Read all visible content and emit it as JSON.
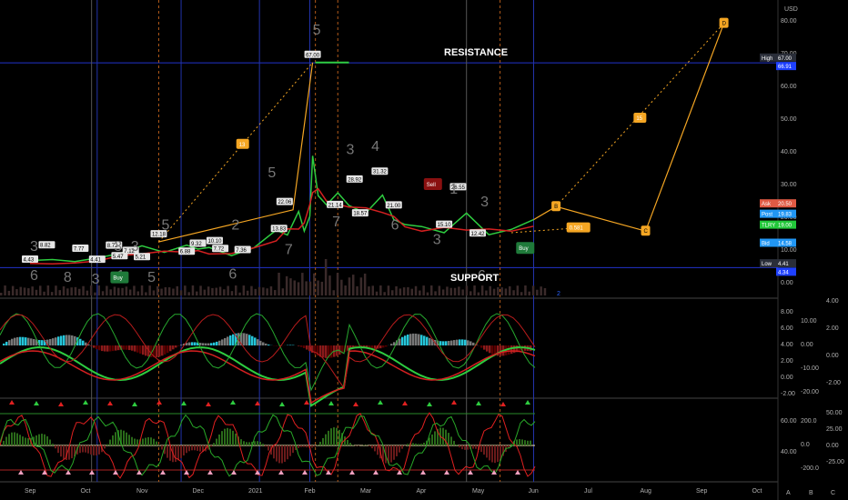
{
  "chart_data": {
    "type": "line",
    "currency": "USD",
    "ylim": [
      0,
      82
    ],
    "x_months": [
      "Sep",
      "Oct",
      "Nov",
      "Dec",
      "2021",
      "Feb",
      "Mar",
      "Apr",
      "May",
      "Jun",
      "Jul",
      "Aug",
      "Sep",
      "Oct"
    ],
    "y_ticks": [
      "80.00",
      "70.00",
      "60.00",
      "50.00",
      "40.00",
      "30.00",
      "20.00",
      "10.00",
      "0.00"
    ],
    "annotations": {
      "resistance": "RESISTANCE",
      "support": "SUPPORT"
    },
    "price_flags": [
      {
        "label": "High",
        "value": "67.00",
        "color": "#2a2e39"
      },
      {
        "label": "",
        "value": "66.91",
        "color": "#1e40ff"
      },
      {
        "label": "Ask",
        "value": "20.50",
        "color": "#e05a44"
      },
      {
        "label": "Post",
        "value": "19.83",
        "color": "#2196f3"
      },
      {
        "label": "TLRY",
        "value": "19.00",
        "color": "#22c83a"
      },
      {
        "label": "Bid",
        "value": "14.58",
        "color": "#2196f3"
      },
      {
        "label": "Low",
        "value": "4.41",
        "color": "#2a2e39"
      },
      {
        "label": "",
        "value": "4.34",
        "color": "#1e40ff"
      }
    ],
    "series": [
      {
        "name": "TLRY",
        "x": [
          0,
          0.4,
          0.8,
          1.2,
          1.6,
          2.0,
          2.4,
          2.8,
          3.0,
          3.2,
          3.6,
          4.0,
          4.4,
          4.6,
          4.8,
          4.9,
          5.0,
          5.05,
          5.15,
          5.3,
          5.5,
          5.7,
          6.0,
          6.3,
          6.5,
          6.7,
          7.0,
          7.4,
          7.8,
          8.2,
          8.6,
          9.0
        ],
        "y": [
          6.5,
          6.8,
          6.2,
          7.3,
          8.6,
          11.0,
          9.0,
          11.2,
          10.0,
          10.5,
          8.0,
          10.4,
          15.8,
          14.3,
          21.5,
          15.5,
          20.0,
          38.5,
          26.3,
          23.5,
          27.2,
          23.3,
          21.0,
          26.5,
          19.0,
          17.5,
          16.9,
          15.0,
          21.0,
          14.4,
          16.0,
          19.0
        ]
      }
    ],
    "labels": [
      {
        "x": 0.0,
        "y": 4.43,
        "text": "4.43"
      },
      {
        "x": 0.3,
        "y": 8.82,
        "text": "8.82"
      },
      {
        "x": 0.9,
        "y": 7.77,
        "text": "7.77"
      },
      {
        "x": 1.2,
        "y": 4.41,
        "text": "4.41"
      },
      {
        "x": 1.5,
        "y": 8.72,
        "text": "8.72"
      },
      {
        "x": 1.6,
        "y": 5.47,
        "text": "5.47"
      },
      {
        "x": 1.8,
        "y": 7.12,
        "text": "7.12"
      },
      {
        "x": 2.0,
        "y": 5.21,
        "text": "5.21"
      },
      {
        "x": 2.3,
        "y": 12.18,
        "text": "12.18"
      },
      {
        "x": 2.8,
        "y": 6.88,
        "text": "6.88"
      },
      {
        "x": 3.0,
        "y": 9.32,
        "text": "9.32"
      },
      {
        "x": 3.3,
        "y": 10.1,
        "text": "10.10"
      },
      {
        "x": 3.4,
        "y": 7.72,
        "text": "7.72"
      },
      {
        "x": 3.8,
        "y": 7.36,
        "text": "7.36"
      },
      {
        "x": 4.45,
        "y": 13.83,
        "text": "13.83"
      },
      {
        "x": 4.55,
        "y": 22.06,
        "text": "22.06"
      },
      {
        "x": 5.05,
        "y": 67.0,
        "text": "67.00"
      },
      {
        "x": 5.45,
        "y": 21.14,
        "text": "21.14"
      },
      {
        "x": 5.8,
        "y": 28.92,
        "text": "28.92"
      },
      {
        "x": 5.9,
        "y": 18.57,
        "text": "18.57"
      },
      {
        "x": 6.25,
        "y": 31.32,
        "text": "31.32"
      },
      {
        "x": 6.5,
        "y": 21.0,
        "text": "21.00"
      },
      {
        "x": 7.4,
        "y": 15.1,
        "text": "15.10"
      },
      {
        "x": 7.65,
        "y": 26.55,
        "text": "26.55"
      },
      {
        "x": 8.0,
        "y": 12.42,
        "text": "12.42"
      }
    ],
    "wave_numbers": [
      {
        "x": 0.0,
        "y": 9.5,
        "text": "3"
      },
      {
        "x": 0.0,
        "y": 0.5,
        "text": "6"
      },
      {
        "x": 0.6,
        "y": 0.0,
        "text": "8"
      },
      {
        "x": 1.1,
        "y": -0.5,
        "text": "3"
      },
      {
        "x": 1.5,
        "y": 9.5,
        "text": "3"
      },
      {
        "x": 1.55,
        "y": 0.5,
        "text": "1"
      },
      {
        "x": 1.8,
        "y": 9.5,
        "text": "3"
      },
      {
        "x": 2.1,
        "y": 0.0,
        "text": "5"
      },
      {
        "x": 2.35,
        "y": 16.0,
        "text": "5"
      },
      {
        "x": 3.6,
        "y": 16.0,
        "text": "2"
      },
      {
        "x": 3.55,
        "y": 1.0,
        "text": "6"
      },
      {
        "x": 4.25,
        "y": 32.0,
        "text": "5"
      },
      {
        "x": 4.55,
        "y": 8.5,
        "text": "7"
      },
      {
        "x": 5.05,
        "y": 75.5,
        "text": "5"
      },
      {
        "x": 5.4,
        "y": 17.0,
        "text": "7"
      },
      {
        "x": 5.65,
        "y": 39.0,
        "text": "3"
      },
      {
        "x": 6.1,
        "y": 40.0,
        "text": "4"
      },
      {
        "x": 6.45,
        "y": 16.0,
        "text": "6"
      },
      {
        "x": 7.2,
        "y": 11.5,
        "text": "3"
      },
      {
        "x": 7.5,
        "y": 27.0,
        "text": "1"
      },
      {
        "x": 8.05,
        "y": 23.0,
        "text": "3"
      },
      {
        "x": 8.0,
        "y": 0.5,
        "text": "6"
      }
    ],
    "projection": [
      {
        "x": 9.4,
        "y": 23.0,
        "text": "B"
      },
      {
        "x": 11.0,
        "y": 15.5,
        "text": "C"
      },
      {
        "x": 12.4,
        "y": 79.0,
        "text": "D"
      }
    ],
    "fib_labels": [
      {
        "x": 3.8,
        "y": 42.0,
        "text": "13"
      },
      {
        "x": 10.9,
        "y": 50.0,
        "text": "15"
      },
      {
        "x": 9.8,
        "y": 16.5,
        "text": "0.581"
      }
    ],
    "signals": [
      {
        "x": 1.6,
        "y": 1.5,
        "text": "Buy"
      },
      {
        "x": 7.2,
        "y": 30.0,
        "text": "Sell"
      },
      {
        "x": 8.85,
        "y": 10.5,
        "text": "Buy"
      }
    ],
    "indicator1_ticks_left": [
      "8.00",
      "6.00",
      "4.00",
      "2.00",
      "0.00",
      "-2.00"
    ],
    "indicator1_ticks_mid": [
      "10.00",
      "0.00",
      "-10.00",
      "-20.00"
    ],
    "indicator1_ticks_right": [
      "4.00",
      "2.00",
      "0.00",
      "-2.00"
    ],
    "indicator2_ticks_left": [
      "60.00",
      "40.00"
    ],
    "indicator2_ticks_mid": [
      "200.0",
      "0.0",
      "-200.0"
    ],
    "indicator2_ticks_right": [
      "50.00",
      "25.00",
      "0.00",
      "-25.00"
    ],
    "ohlc_note": "2",
    "bottom_buttons": [
      "A",
      "B",
      "C"
    ]
  }
}
